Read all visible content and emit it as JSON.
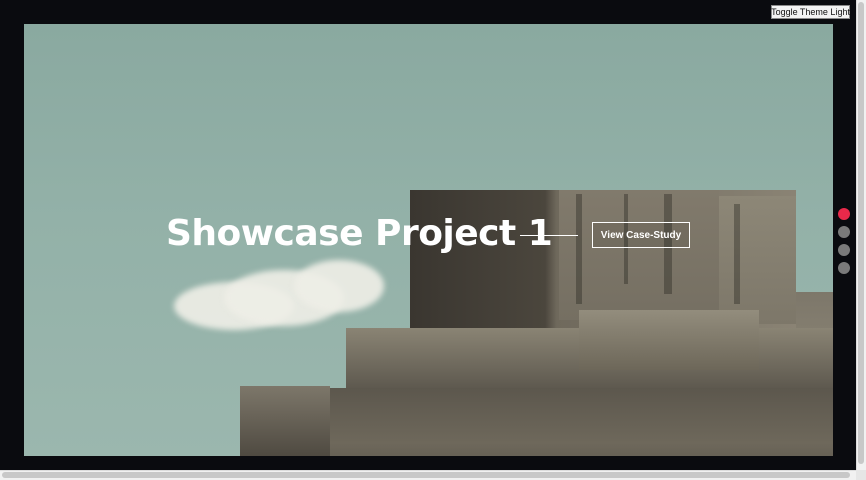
{
  "theme_toggle": {
    "label": "Toggle Theme Light"
  },
  "slide": {
    "title": "Showcase Project 1",
    "cta_label": "View Case-Study"
  },
  "pagination": {
    "total": 4,
    "active_index": 0,
    "active_color": "#e8294a",
    "inactive_color": "#7a7a7a"
  },
  "colors": {
    "frame": "#0a0b0f",
    "sky": "#93b1a8",
    "text": "#ffffff"
  }
}
